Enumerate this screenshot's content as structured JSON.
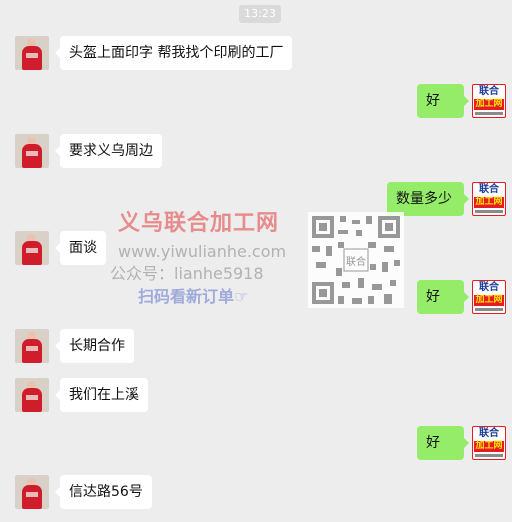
{
  "chat": {
    "timestamp": "13:23",
    "messages": [
      {
        "side": "left",
        "avatar": "user-avatar",
        "text": "头盔上面印字  帮我找个印刷的工厂"
      },
      {
        "side": "right",
        "avatar": "company-logo-avatar",
        "text": "好"
      },
      {
        "side": "left",
        "avatar": "user-avatar",
        "text": "要求义乌周边"
      },
      {
        "side": "right",
        "avatar": "company-logo-avatar",
        "text": "数量多少"
      },
      {
        "side": "left",
        "avatar": "user-avatar",
        "text": "面谈"
      },
      {
        "side": "right",
        "avatar": "company-logo-avatar",
        "text": "好"
      },
      {
        "side": "left",
        "avatar": "user-avatar",
        "text": "长期合作"
      },
      {
        "side": "left",
        "avatar": "user-avatar",
        "text": "我们在上溪"
      },
      {
        "side": "right",
        "avatar": "company-logo-avatar",
        "text": "好"
      },
      {
        "side": "left",
        "avatar": "user-avatar",
        "text": "信达路56号"
      }
    ]
  },
  "logo": {
    "line1": "联合",
    "line2": "加工网"
  },
  "watermark": {
    "title": "义乌联合加工网",
    "url": "www.yiwulianhe.com",
    "account": "公众号：lianhe5918",
    "cta": "扫码看新订单☞",
    "qr_center": "联合"
  },
  "colors": {
    "background": "#ededed",
    "incoming_bubble": "#ffffff",
    "outgoing_bubble": "#95ec69",
    "logo_red": "#e51d22",
    "logo_blue": "#1c3d9a",
    "logo_yellow": "#ffe400"
  }
}
